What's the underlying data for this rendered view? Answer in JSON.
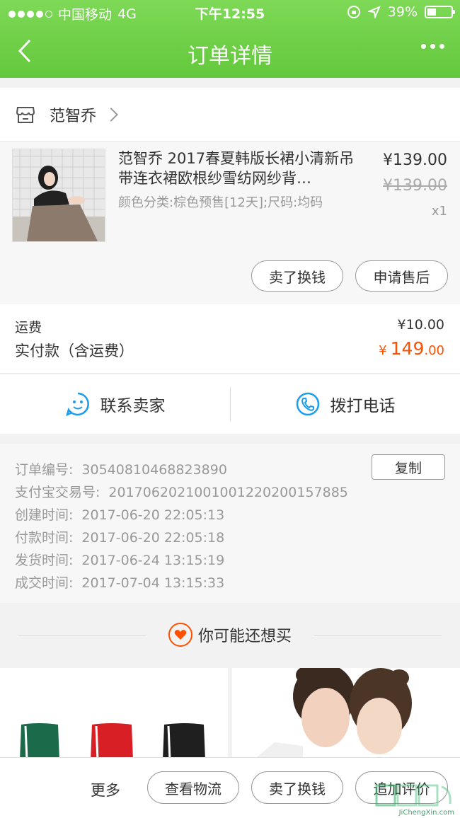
{
  "status_bar": {
    "carrier": "中国移动",
    "network": "4G",
    "time": "下午12:55",
    "battery_pct": "39%",
    "battery_level": 0.39
  },
  "nav": {
    "title": "订单详情"
  },
  "shop": {
    "name": "范智乔",
    "icon": "shop-icon"
  },
  "product": {
    "title": "范智乔 2017春夏韩版长裙小清新吊带连衣裙欧根纱雪纺网纱背…",
    "sku": "颜色分类:棕色预售[12天];尺码:均码",
    "price": "¥139.00",
    "original_price": "¥139.00",
    "quantity": "x1",
    "sell_button": "卖了换钱",
    "aftersale_button": "申请售后"
  },
  "fees": {
    "shipping_label": "运费",
    "shipping_value": "¥10.00",
    "paid_label": "实付款（含运费）",
    "paid_symbol": "¥",
    "paid_int": "149",
    "paid_dec": ".00",
    "accent": "#ff5000"
  },
  "contact": {
    "seller_label": "联系卖家",
    "phone_label": "拨打电话",
    "icon_color": "#1a9cf0"
  },
  "order_info": {
    "copy_button": "复制",
    "rows": [
      {
        "label": "订单编号:",
        "value": "30540810468823890"
      },
      {
        "label": "支付宝交易号:",
        "value": "2017062021001001220200157885"
      },
      {
        "label": "创建时间:",
        "value": "2017-06-20 22:05:13"
      },
      {
        "label": "付款时间:",
        "value": "2017-06-20 22:05:18"
      },
      {
        "label": "发货时间:",
        "value": "2017-06-24 13:15:19"
      },
      {
        "label": "成交时间:",
        "value": "2017-07-04 13:15:33"
      }
    ]
  },
  "recommend": {
    "title": "你可能还想买"
  },
  "bottom_bar": {
    "more": "更多",
    "logistics": "查看物流",
    "sell": "卖了换钱",
    "review": "追加评价"
  },
  "watermark": {
    "text": "JiChengXin.com"
  },
  "colors": {
    "header_green": "#6ccf44",
    "price_orange": "#ff5000"
  }
}
